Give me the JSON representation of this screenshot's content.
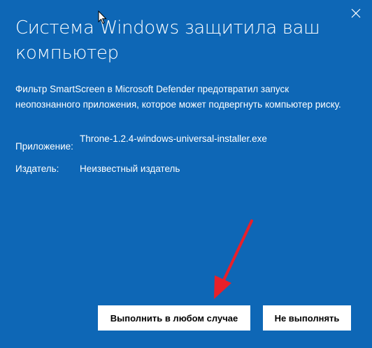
{
  "dialog": {
    "title": "Система Windows защитила ваш компьютер",
    "description": "Фильтр SmartScreen в Microsoft Defender предотвратил запуск неопознанного приложения, которое может подвергнуть компьютер риску.",
    "app_label": "Приложение:",
    "app_value": "Throne-1.2.4-windows-universal-installer.exe",
    "publisher_label": "Издатель:",
    "publisher_value": "Неизвестный издатель",
    "run_anyway_label": "Выполнить в любом случае",
    "dont_run_label": "Не выполнять"
  },
  "icons": {
    "close": "close-icon",
    "cursor": "mouse-cursor-icon",
    "annotation": "red-arrow-annotation"
  },
  "colors": {
    "background": "#0e67b6",
    "text": "#ffffff",
    "button_bg": "#ffffff",
    "button_text": "#000000",
    "arrow": "#e8202a"
  }
}
